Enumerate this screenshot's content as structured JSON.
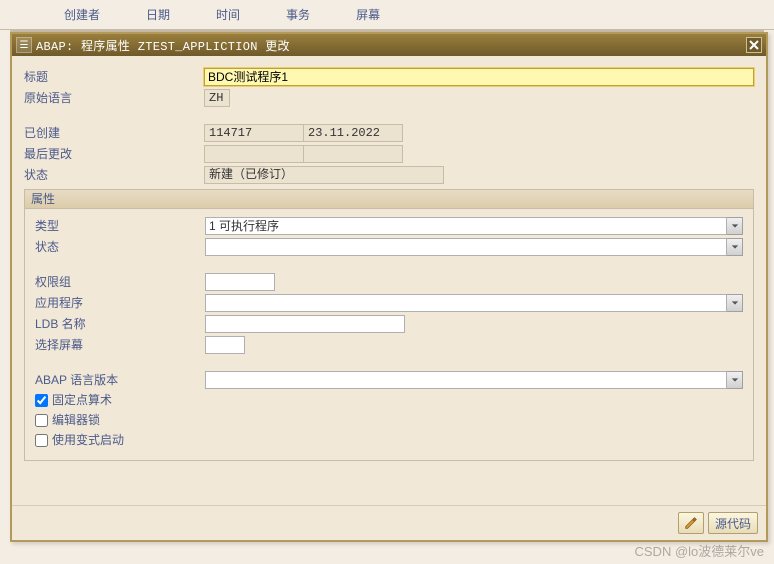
{
  "bg_tabs": [
    "创建者",
    "日期",
    "时间",
    "事务",
    "屏幕"
  ],
  "dialog": {
    "title": "ABAP: 程序属性 ZTEST_APPLICTION 更改"
  },
  "fields": {
    "title_label": "标题",
    "title_value": "BDC测试程序1",
    "orig_lang_label": "原始语言",
    "orig_lang_value": "ZH",
    "created_label": "已创建",
    "created_value1": "114717",
    "created_value2": "23.11.2022",
    "last_change_label": "最后更改",
    "last_change_value1": "",
    "last_change_value2": "",
    "status_label": "状态",
    "status_value": "新建（已修订）"
  },
  "attributes": {
    "header": "属性",
    "type_label": "类型",
    "type_value": "1 可执行程序",
    "status2_label": "状态",
    "status2_value": "",
    "auth_group_label": "权限组",
    "auth_group_value": "",
    "applprog_label": "应用程序",
    "applprog_value": "",
    "ldb_label": "LDB 名称",
    "ldb_value": "",
    "sel_screen_label": "选择屏幕",
    "sel_screen_value": "",
    "abap_ver_label": "ABAP 语言版本",
    "abap_ver_value": "",
    "ck_fixed_label": "固定点算术",
    "ck_fixed_checked": true,
    "ck_editor_label": "编辑器锁",
    "ck_editor_checked": false,
    "ck_variant_label": "使用变式启动",
    "ck_variant_checked": false
  },
  "footer": {
    "source_btn": "源代码"
  },
  "watermark": "CSDN @lo波德莱尔ve"
}
